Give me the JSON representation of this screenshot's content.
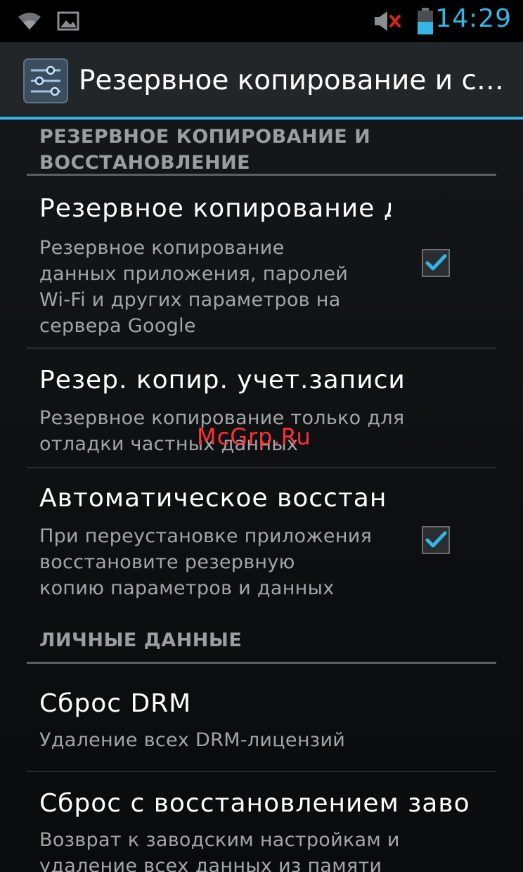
{
  "status_bar": {
    "time": "14:29",
    "icons": [
      "wifi-icon",
      "picture-icon",
      "speaker-muted-icon",
      "battery-icon"
    ],
    "time_color": "#33b5e5"
  },
  "action_bar": {
    "title": "Резервное копирование и сб…",
    "icon": "settings-sliders-icon",
    "accent_color": "#33b5e5"
  },
  "sections": [
    {
      "header_line1": "РЕЗЕРВНОЕ КОПИРОВАНИЕ И",
      "header_line2": "ВОССТАНОВЛЕНИЕ",
      "items": [
        {
          "title": "Резервное копирование д",
          "summary_lines": [
            "Резервное копирование",
            "данных приложения, паролей",
            "Wi-Fi и других параметров на",
            "сервера Google"
          ],
          "checked": true
        },
        {
          "title": "Резер. копир. учет.записи",
          "summary_lines": [
            "Резервное копирование только для",
            "отладки частных данных"
          ]
        },
        {
          "title": "Автоматическое восстан",
          "summary_lines": [
            "При переустановке приложения",
            "восстановите резервную",
            "копию параметров и данных"
          ],
          "checked": true
        }
      ]
    },
    {
      "header_line1": "ЛИЧНЫЕ ДАННЫЕ",
      "items": [
        {
          "title": "Сброс DRM",
          "summary_lines": [
            "Удаление всех DRM-лицензий"
          ]
        },
        {
          "title": "Сброс с восстановлением заво",
          "summary_lines": [
            "Возврат к заводским настройкам и",
            "удаление всех данных из памяти"
          ]
        }
      ]
    }
  ],
  "watermark": "McGrp.Ru"
}
